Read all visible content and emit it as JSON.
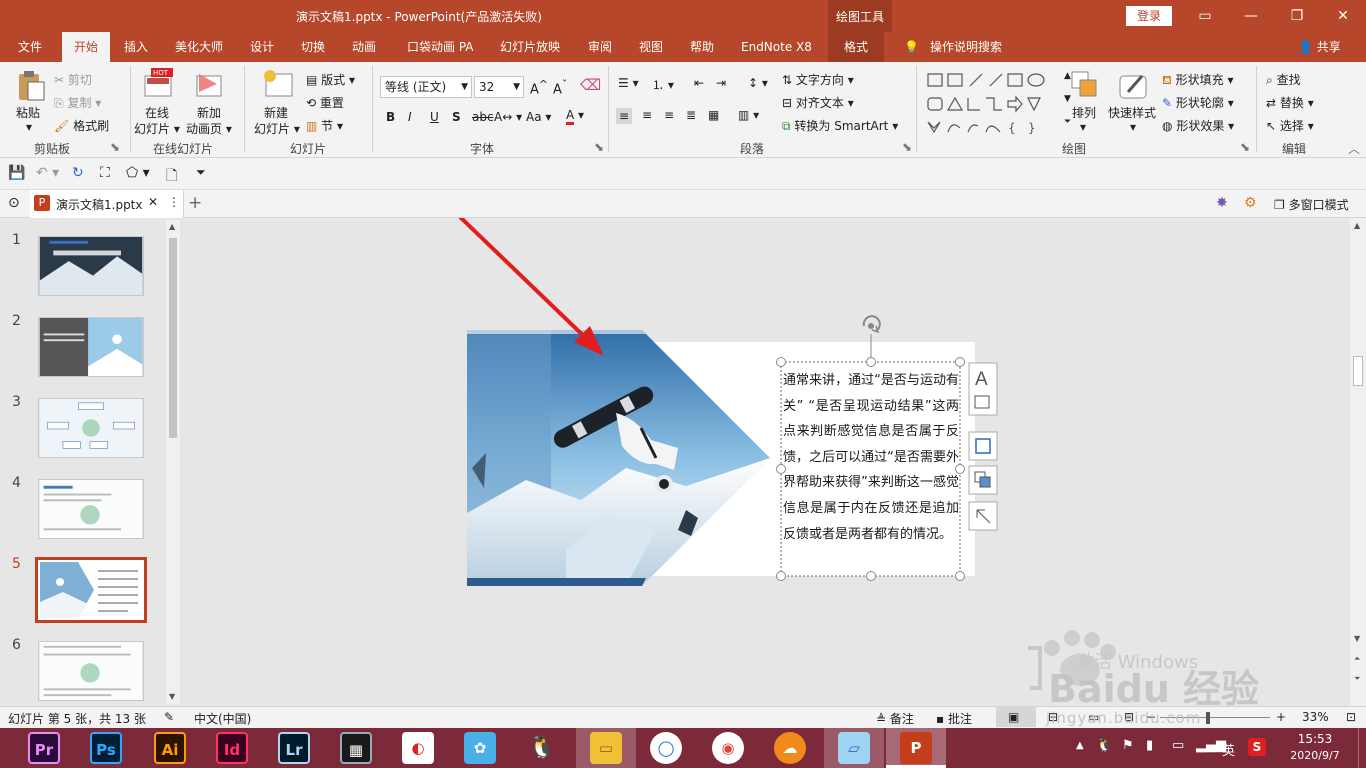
{
  "titlebar": {
    "title": "演示文稿1.pptx  -  PowerPoint(产品激活失败)",
    "context_tools": "绘图工具",
    "login": "登录"
  },
  "tabs": [
    "文件",
    "开始",
    "插入",
    "美化大师",
    "设计",
    "切换",
    "动画",
    "口袋动画 PA",
    "幻灯片放映",
    "审阅",
    "视图",
    "帮助",
    "EndNote X8",
    "格式"
  ],
  "tell_me": "操作说明搜索",
  "share": "共享",
  "ribbon": {
    "clipboard": {
      "paste": "粘贴",
      "cut": "剪切",
      "copy": "复制",
      "format_painter": "格式刷",
      "label": "剪贴板"
    },
    "online_slides": {
      "online_slide_1": "在线",
      "online_slide_2": "幻灯片",
      "new_anim_1": "新加",
      "new_anim_2": "动画页",
      "label": "在线幻灯片",
      "hot_badge": "HOT"
    },
    "slides": {
      "new_slide_1": "新建",
      "new_slide_2": "幻灯片",
      "layout": "版式",
      "reset": "重置",
      "section": "节",
      "label": "幻灯片"
    },
    "font": {
      "font_name": "等线 (正文)",
      "font_size": "32",
      "label": "字体"
    },
    "paragraph": {
      "text_direction": "文字方向",
      "align_text": "对齐文本",
      "smartart": "转换为 SmartArt",
      "label": "段落"
    },
    "drawing": {
      "arrange": "排列",
      "quick_styles": "快速样式",
      "shape_fill": "形状填充",
      "shape_outline": "形状轮廓",
      "shape_effects": "形状效果",
      "label": "绘图"
    },
    "editing": {
      "find": "查找",
      "replace": "替换",
      "select": "选择",
      "label": "编辑"
    }
  },
  "doc_tab": {
    "name": "演示文稿1.pptx",
    "multiwindow": "多窗口模式"
  },
  "thumbnails": [
    {
      "num": "1",
      "active": false
    },
    {
      "num": "2",
      "active": false
    },
    {
      "num": "3",
      "active": false
    },
    {
      "num": "4",
      "active": false
    },
    {
      "num": "5",
      "active": true
    },
    {
      "num": "6",
      "active": false
    }
  ],
  "slide": {
    "textbox": "通常来讲，通过“是否与运动有关” “是否呈现运动结果”这两点来判断感觉信息是否属于反馈，之后可以通过“是否需要外界帮助来获得”来判断这一感觉信息是属于内在反馈还是追加反馈或者是两者都有的情况。",
    "watermark_top": "激活 Windows",
    "watermark_baidu": "Baidu 经验",
    "watermark_url": "jingyan.baidu.com"
  },
  "status": {
    "slide_info": "幻灯片 第 5 张，共 13 张",
    "language": "中文(中国)",
    "notes": "备注",
    "comments": "批注",
    "zoom": "33%"
  },
  "taskbar": {
    "apps": [
      "Pr",
      "Ps",
      "Ai",
      "Id",
      "Lr"
    ],
    "ime": "英",
    "time": "15:53",
    "date": "2020/9/7"
  },
  "colors": {
    "accent": "#b7472a",
    "selection": "#c43e1c",
    "arrow": "#e01e1e"
  }
}
